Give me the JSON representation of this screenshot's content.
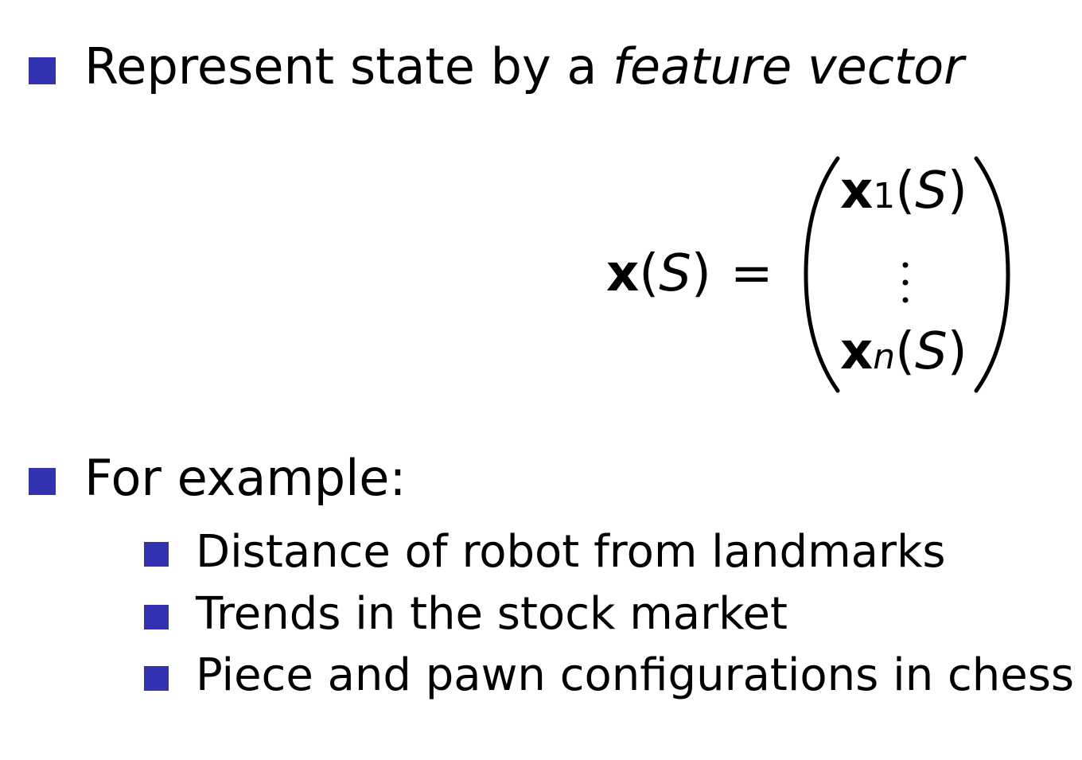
{
  "bullets": [
    {
      "text_before": "Represent state by a ",
      "text_emphasis": "feature vector"
    },
    {
      "text": "For example:",
      "items": [
        "Distance of robot from landmarks",
        "Trends in the stock market",
        "Piece and pawn configurations in chess"
      ]
    }
  ],
  "equation": {
    "lhs_symbol": "x",
    "lhs_arg_open": "(",
    "lhs_arg": "S",
    "lhs_arg_close": ")",
    "equals": "=",
    "first_entry_symbol": "x",
    "first_entry_index": "1",
    "entry_arg_open": "(",
    "entry_arg": "S",
    "entry_arg_close": ")",
    "last_entry_symbol": "x",
    "last_entry_index": "n"
  },
  "colors": {
    "bullet": "#3333b2",
    "text": "#000000"
  }
}
